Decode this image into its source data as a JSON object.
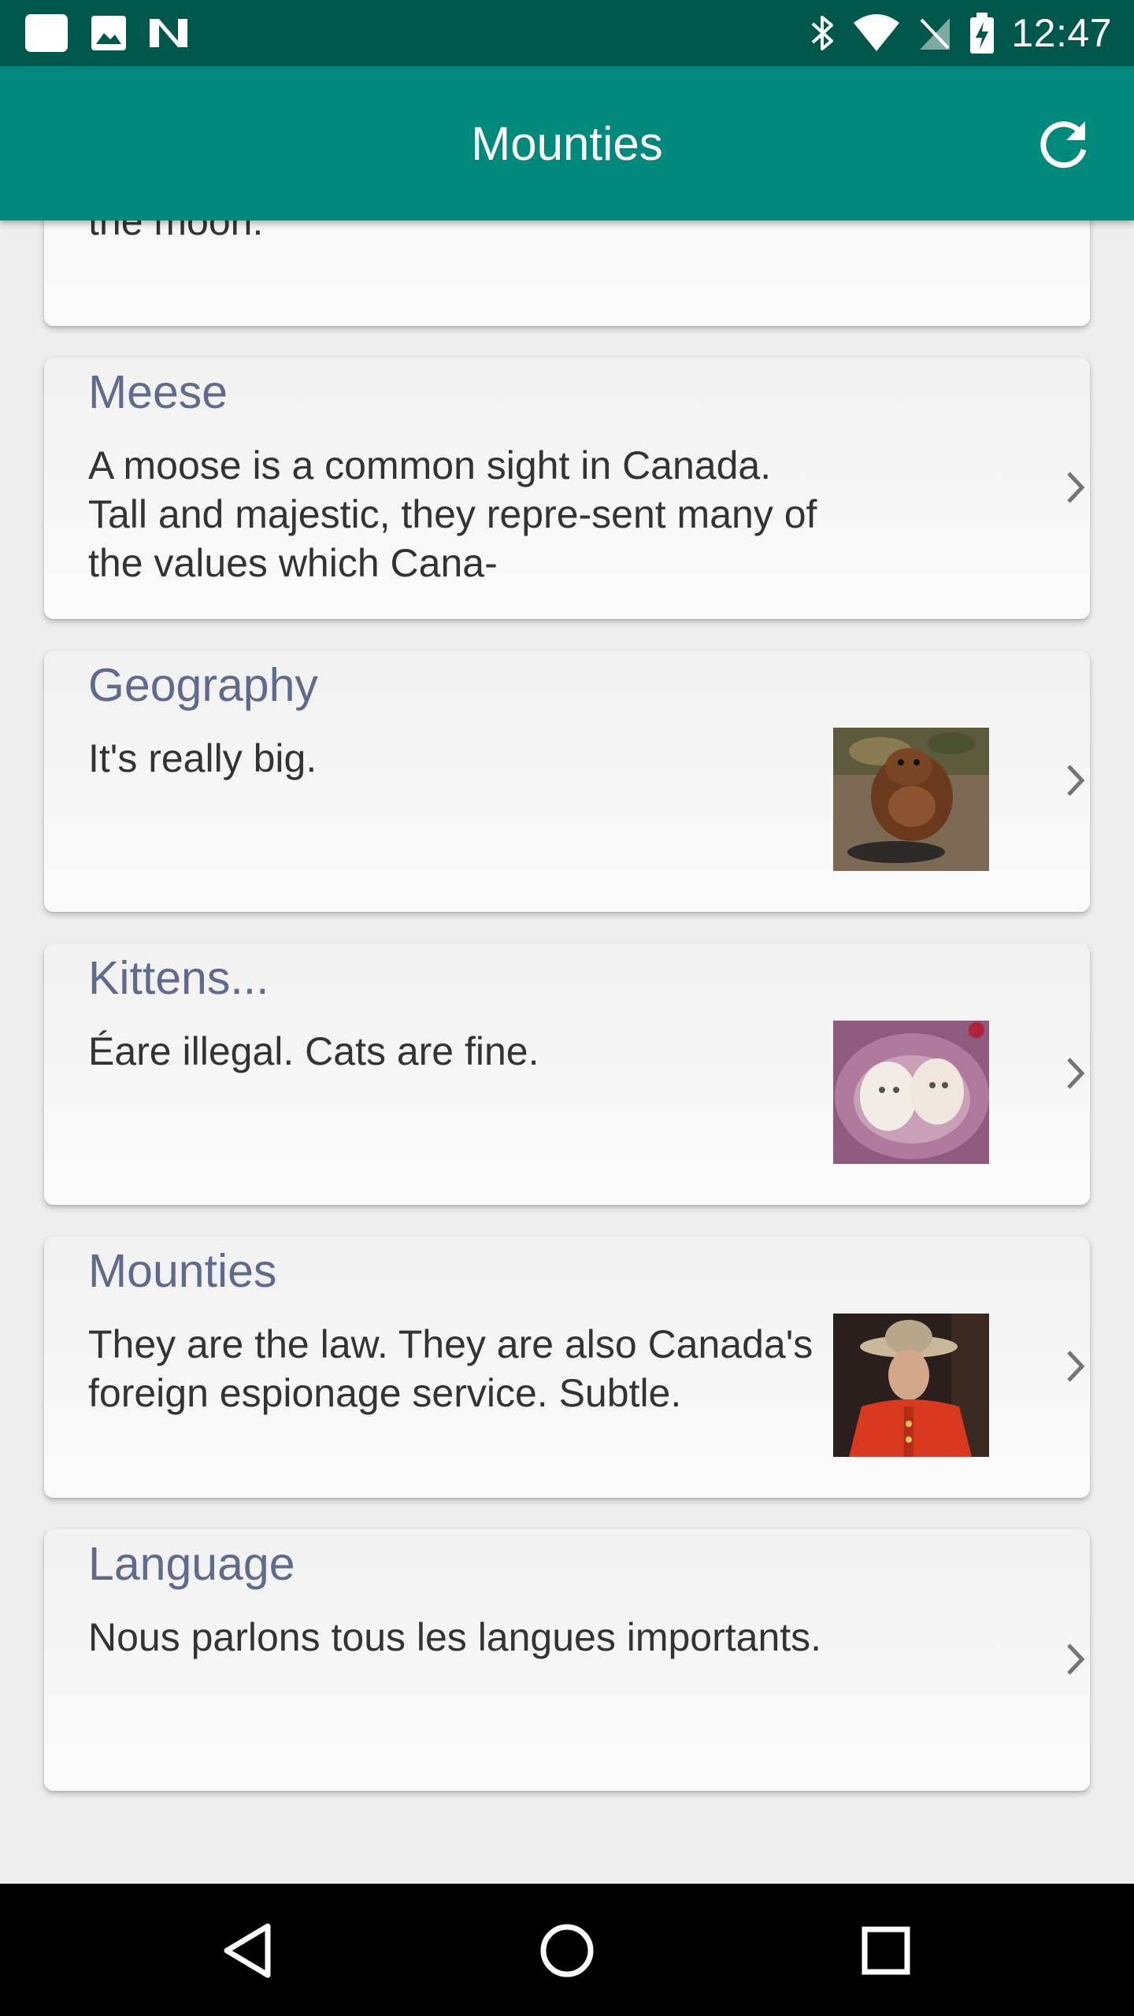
{
  "status_bar": {
    "time": "12:47",
    "left_icons": [
      "notification-icon",
      "image-icon",
      "n-logo-icon"
    ],
    "right_icons": [
      "bluetooth-icon",
      "wifi-icon",
      "no-sim-icon",
      "battery-charging-icon"
    ]
  },
  "app_bar": {
    "title": "Mounties",
    "background": "#00897b",
    "refresh_icon": "refresh-icon"
  },
  "cards": [
    {
      "title": "",
      "body": "Canada hopes to soon launch a man to the moon.",
      "thumbnail": null
    },
    {
      "title": "Meese",
      "body": "A moose is a common sight in Canada. Tall and majestic, they repre-sent many of the values which Cana-",
      "thumbnail": null
    },
    {
      "title": "Geography",
      "body": "It's really big.",
      "thumbnail": "beaver-photo"
    },
    {
      "title": "Kittens...",
      "body": "Éare illegal. Cats are fine.",
      "thumbnail": "kittens-photo"
    },
    {
      "title": "Mounties",
      "body": "They are the law. They are also Canada's foreign espionage service. Subtle.",
      "thumbnail": "mountie-photo"
    },
    {
      "title": "Language",
      "body": "Nous parlons tous les langues importants.",
      "thumbnail": null
    }
  ],
  "nav_bar": {
    "buttons": [
      "back-icon",
      "home-icon",
      "recents-icon"
    ]
  },
  "colors": {
    "status_bar": "#00574b",
    "app_bar": "#00897b",
    "title_text": "#606a8c",
    "body_text": "#333333"
  }
}
